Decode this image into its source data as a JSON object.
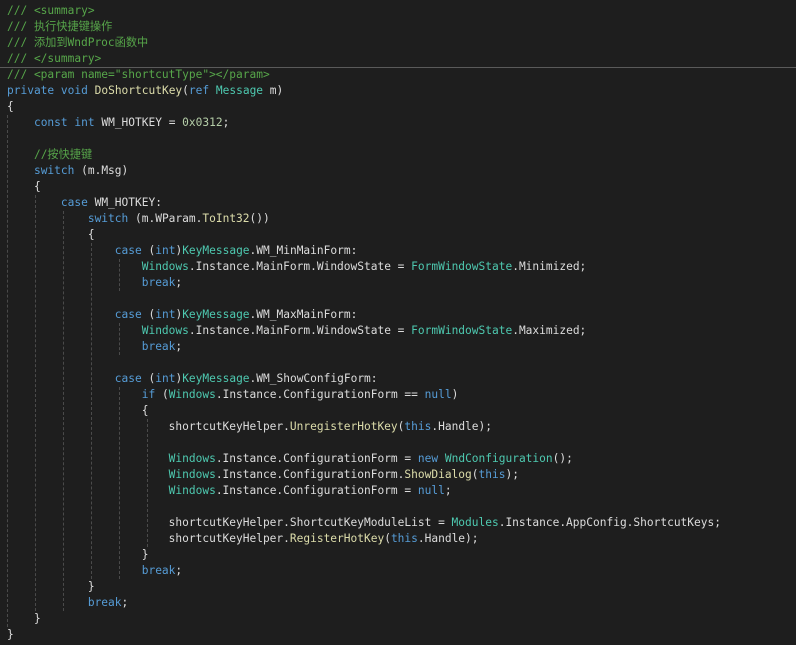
{
  "editor": {
    "lines": [
      [
        [
          "c",
          "/// <summary>"
        ]
      ],
      [
        [
          "c",
          "/// 执行快捷键操作"
        ]
      ],
      [
        [
          "c",
          "/// 添加到WndProc函数中"
        ]
      ],
      [
        [
          "c",
          "/// </summary>"
        ]
      ],
      [
        [
          "c",
          "/// <param name=\"shortcutType\"></param>"
        ]
      ],
      [
        [
          "k",
          "private"
        ],
        [
          "p",
          " "
        ],
        [
          "k",
          "void"
        ],
        [
          "p",
          " "
        ],
        [
          "m",
          "DoShortcutKey"
        ],
        [
          "p",
          "("
        ],
        [
          "k",
          "ref"
        ],
        [
          "p",
          " "
        ],
        [
          "t",
          "Message"
        ],
        [
          "p",
          " m)"
        ]
      ],
      [
        [
          "p",
          "{"
        ]
      ],
      [
        [
          "p",
          "    "
        ],
        [
          "k",
          "const"
        ],
        [
          "p",
          " "
        ],
        [
          "k",
          "int"
        ],
        [
          "p",
          " WM_HOTKEY = "
        ],
        [
          "n",
          "0x0312"
        ],
        [
          "p",
          ";"
        ]
      ],
      [],
      [
        [
          "p",
          "    "
        ],
        [
          "c",
          "//按快捷键"
        ]
      ],
      [
        [
          "p",
          "    "
        ],
        [
          "k",
          "switch"
        ],
        [
          "p",
          " (m.Msg)"
        ]
      ],
      [
        [
          "p",
          "    {"
        ]
      ],
      [
        [
          "p",
          "        "
        ],
        [
          "k",
          "case"
        ],
        [
          "p",
          " WM_HOTKEY:"
        ]
      ],
      [
        [
          "p",
          "            "
        ],
        [
          "k",
          "switch"
        ],
        [
          "p",
          " (m."
        ],
        [
          "p",
          "WParam"
        ],
        [
          "p",
          "."
        ],
        [
          "m",
          "ToInt32"
        ],
        [
          "p",
          "())"
        ]
      ],
      [
        [
          "p",
          "            {"
        ]
      ],
      [
        [
          "p",
          "                "
        ],
        [
          "k",
          "case"
        ],
        [
          "p",
          " ("
        ],
        [
          "k",
          "int"
        ],
        [
          "p",
          ")"
        ],
        [
          "t",
          "KeyMessage"
        ],
        [
          "p",
          ".WM_MinMainForm:"
        ]
      ],
      [
        [
          "p",
          "                    "
        ],
        [
          "t",
          "Windows"
        ],
        [
          "p",
          ".Instance.MainForm.WindowState = "
        ],
        [
          "t",
          "FormWindowState"
        ],
        [
          "p",
          ".Minimized;"
        ]
      ],
      [
        [
          "p",
          "                    "
        ],
        [
          "k",
          "break"
        ],
        [
          "p",
          ";"
        ]
      ],
      [],
      [
        [
          "p",
          "                "
        ],
        [
          "k",
          "case"
        ],
        [
          "p",
          " ("
        ],
        [
          "k",
          "int"
        ],
        [
          "p",
          ")"
        ],
        [
          "t",
          "KeyMessage"
        ],
        [
          "p",
          ".WM_MaxMainForm:"
        ]
      ],
      [
        [
          "p",
          "                    "
        ],
        [
          "t",
          "Windows"
        ],
        [
          "p",
          ".Instance.MainForm.WindowState = "
        ],
        [
          "t",
          "FormWindowState"
        ],
        [
          "p",
          ".Maximized;"
        ]
      ],
      [
        [
          "p",
          "                    "
        ],
        [
          "k",
          "break"
        ],
        [
          "p",
          ";"
        ]
      ],
      [],
      [
        [
          "p",
          "                "
        ],
        [
          "k",
          "case"
        ],
        [
          "p",
          " ("
        ],
        [
          "k",
          "int"
        ],
        [
          "p",
          ")"
        ],
        [
          "t",
          "KeyMessage"
        ],
        [
          "p",
          ".WM_ShowConfigForm:"
        ]
      ],
      [
        [
          "p",
          "                    "
        ],
        [
          "k",
          "if"
        ],
        [
          "p",
          " ("
        ],
        [
          "t",
          "Windows"
        ],
        [
          "p",
          ".Instance.ConfigurationForm == "
        ],
        [
          "k",
          "null"
        ],
        [
          "p",
          ")"
        ]
      ],
      [
        [
          "p",
          "                    {"
        ]
      ],
      [
        [
          "p",
          "                        shortcutKeyHelper."
        ],
        [
          "m",
          "UnregisterHotKey"
        ],
        [
          "p",
          "("
        ],
        [
          "k",
          "this"
        ],
        [
          "p",
          ".Handle);"
        ]
      ],
      [],
      [
        [
          "p",
          "                        "
        ],
        [
          "t",
          "Windows"
        ],
        [
          "p",
          ".Instance.ConfigurationForm = "
        ],
        [
          "k",
          "new"
        ],
        [
          "p",
          " "
        ],
        [
          "t",
          "WndConfiguration"
        ],
        [
          "p",
          "();"
        ]
      ],
      [
        [
          "p",
          "                        "
        ],
        [
          "t",
          "Windows"
        ],
        [
          "p",
          ".Instance.ConfigurationForm."
        ],
        [
          "m",
          "ShowDialog"
        ],
        [
          "p",
          "("
        ],
        [
          "k",
          "this"
        ],
        [
          "p",
          ");"
        ]
      ],
      [
        [
          "p",
          "                        "
        ],
        [
          "t",
          "Windows"
        ],
        [
          "p",
          ".Instance.ConfigurationForm = "
        ],
        [
          "k",
          "null"
        ],
        [
          "p",
          ";"
        ]
      ],
      [],
      [
        [
          "p",
          "                        shortcutKeyHelper.ShortcutKeyModuleList = "
        ],
        [
          "t",
          "Modules"
        ],
        [
          "p",
          ".Instance.AppConfig.ShortcutKeys;"
        ]
      ],
      [
        [
          "p",
          "                        shortcutKeyHelper."
        ],
        [
          "m",
          "RegisterHotKey"
        ],
        [
          "p",
          "("
        ],
        [
          "k",
          "this"
        ],
        [
          "p",
          ".Handle);"
        ]
      ],
      [
        [
          "p",
          "                    }"
        ]
      ],
      [
        [
          "p",
          "                    "
        ],
        [
          "k",
          "break"
        ],
        [
          "p",
          ";"
        ]
      ],
      [
        [
          "p",
          "            }"
        ]
      ],
      [
        [
          "p",
          "            "
        ],
        [
          "k",
          "break"
        ],
        [
          "p",
          ";"
        ]
      ],
      [
        [
          "p",
          "    }"
        ]
      ],
      [
        [
          "p",
          "}"
        ]
      ]
    ]
  }
}
